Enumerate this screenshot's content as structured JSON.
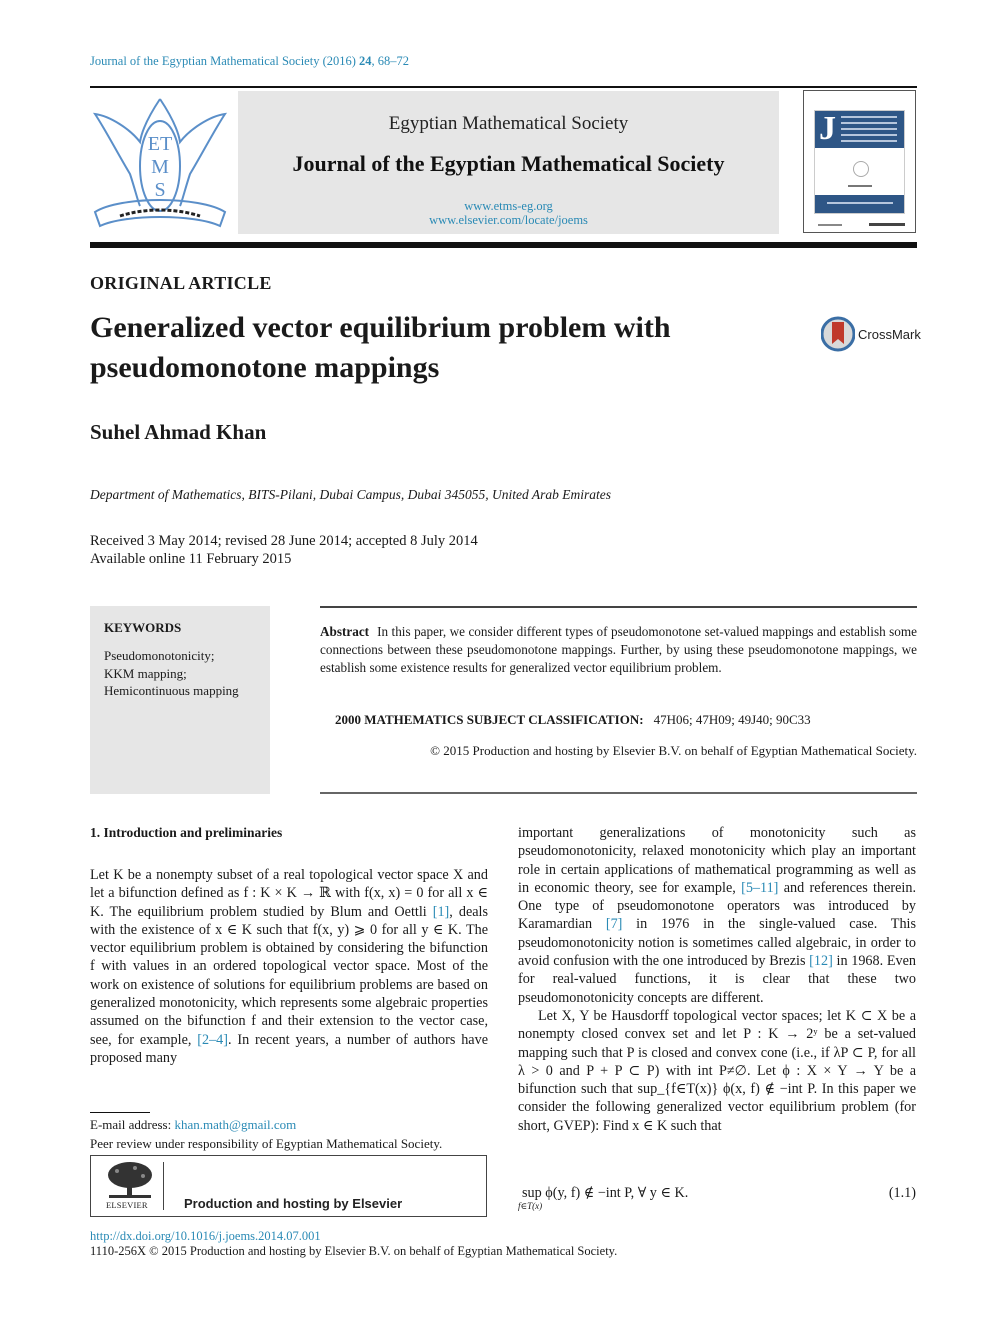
{
  "header": {
    "citation": {
      "journal": "Journal of the Egyptian Mathematical Society (2016)",
      "volume": "24",
      "pages": ", 68–72"
    },
    "society_name": "Egyptian Mathematical Society",
    "journal_name": "Journal of the Egyptian Mathematical Society",
    "url_society": "www.etms-eg.org",
    "url_elsevier": "www.elsevier.com/locate/joems",
    "logo_letters": [
      "ET",
      "M",
      "S"
    ],
    "cover_initial": "J"
  },
  "article": {
    "type": "ORIGINAL ARTICLE",
    "title": "Generalized vector equilibrium problem with pseudomonotone mappings",
    "crossmark_label": "CrossMark",
    "author": "Suhel Ahmad Khan",
    "affiliation": "Department of Mathematics, BITS-Pilani, Dubai Campus, Dubai 345055, United Arab Emirates",
    "dates": {
      "history": "Received 3 May 2014; revised 28 June 2014; accepted 8 July 2014",
      "online": "Available online 11 February 2015"
    }
  },
  "keywords": {
    "heading": "KEYWORDS",
    "items": [
      "Pseudomonotonicity;",
      "KKM mapping;",
      "Hemicontinuous mapping"
    ]
  },
  "abstract": {
    "label": "Abstract",
    "text": "In this paper, we consider different types of pseudomonotone set-valued mappings and establish some connections between these pseudomonotone mappings. Further, by using these pseudomonotone mappings, we establish some existence results for generalized vector equilibrium problem.",
    "msc_label": "2000 MATHEMATICS SUBJECT CLASSIFICATION:",
    "msc_codes": "47H06; 47H09; 49J40; 90C33",
    "copyright": "© 2015 Production and hosting by Elsevier B.V. on behalf of Egyptian Mathematical Society."
  },
  "body": {
    "section_heading": "1. Introduction and preliminaries",
    "left": {
      "p1_a": "Let K be a nonempty subset of a real topological vector space X and let a bifunction defined as f : K × K → ℝ with f(x, x) = 0 for all x ∈ K. The equilibrium problem studied by Blum and Oettli ",
      "ref1": "[1]",
      "p1_b": ", deals with the existence of x ∈ K such that f(x, y) ⩾ 0 for all y ∈ K. The vector equilibrium problem is obtained by considering the bifunction f with values in an ordered topological vector space. Most of the work on existence of solutions for equilibrium problems are based on generalized monotonicity, which represents some algebraic properties assumed on the bifunction f and their extension to the vector case, see, for example, ",
      "ref2": "[2–4]",
      "p1_c": ". In recent years, a number of authors have proposed many"
    },
    "right": {
      "p1_a": "important generalizations of monotonicity such as pseudomonotonicity, relaxed monotonicity which play an important role in certain applications of mathematical programming as well as in economic theory, see for example, ",
      "ref3": "[5–11]",
      "p1_b": " and references therein. One type of pseudomonotone operators was introduced by Karamardian ",
      "ref4": "[7]",
      "p1_c": " in 1976 in the single-valued case. This pseudomonotonicity notion is sometimes called algebraic, in order to avoid confusion with the one introduced by Brezis ",
      "ref5": "[12]",
      "p1_d": " in 1968. Even for real-valued functions, it is clear that these two pseudomonotonicity concepts are different.",
      "p2": "Let X, Y be Hausdorff topological vector spaces; let K ⊂ X be a nonempty closed convex set and let P : K → 2ʸ be a set-valued mapping such that P is closed and convex cone (i.e., if λP ⊂ P, for all λ > 0 and P + P ⊂ P) with int P≠∅. Let ϕ : X × Y → Y be a bifunction such that sup_{f∈T(x)} ϕ(x, f) ∉ −int P. In this paper we consider the following generalized vector equilibrium problem (for short, GVEP): Find x ∈ K such that"
    },
    "equation": {
      "main": "sup ϕ(y, f) ∉ −int P,    ∀ y ∈ K.",
      "subscript": "f∈T(x)",
      "number": "(1.1)"
    }
  },
  "footnotes": {
    "email_label": "E-mail address: ",
    "email": "khan.math@gmail.com",
    "peer_review": "Peer review under responsibility of Egyptian Mathematical Society.",
    "elsevier_wordmark": "ELSEVIER",
    "production": "Production and hosting by Elsevier"
  },
  "footer": {
    "doi": "http://dx.doi.org/10.1016/j.joems.2014.07.001",
    "issn_line": "1110-256X © 2015 Production and hosting by Elsevier B.V. on behalf of Egyptian Mathematical Society."
  }
}
